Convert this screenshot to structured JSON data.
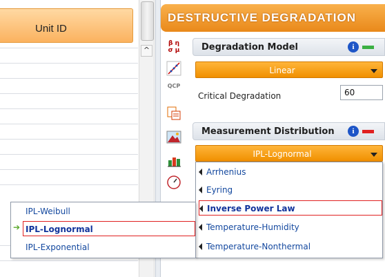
{
  "grid": {
    "column_header": "Unit ID",
    "scroll_up": "^"
  },
  "panel": {
    "title": "Destructive Degradation",
    "degradation_model": {
      "header": "Degradation Model",
      "selected": "Linear",
      "critical_label": "Critical Degradation",
      "critical_value": "60",
      "status_color": "#3cb043"
    },
    "measurement_distribution": {
      "header": "Measurement Distribution",
      "selected": "IPL-Lognormal",
      "status_color": "#e02020"
    }
  },
  "life_stress_menu": {
    "items": [
      {
        "label": "Arrhenius",
        "selected": false
      },
      {
        "label": "Eyring",
        "selected": false
      },
      {
        "label": "Inverse Power Law",
        "selected": true
      },
      {
        "label": "Temperature-Humidity",
        "selected": false
      },
      {
        "label": "Temperature-Nonthermal",
        "selected": false
      }
    ]
  },
  "distribution_submenu": {
    "items": [
      {
        "label": "IPL-Weibull",
        "selected": false
      },
      {
        "label": "IPL-Lognormal",
        "selected": true
      },
      {
        "label": "IPL-Exponential",
        "selected": false
      }
    ]
  },
  "toolbar": {
    "icons": [
      "parameters-icon",
      "plot-icon",
      "qcp-icon",
      "report-icon",
      "mountain-chart-icon",
      "bar-chart-icon",
      "gauge-icon"
    ],
    "qcp_label": "QCP",
    "param_label": "β η σ μ"
  },
  "colors": {
    "accent_orange": "#f09000",
    "link_blue": "#12479e",
    "highlight_red": "#e02020"
  }
}
